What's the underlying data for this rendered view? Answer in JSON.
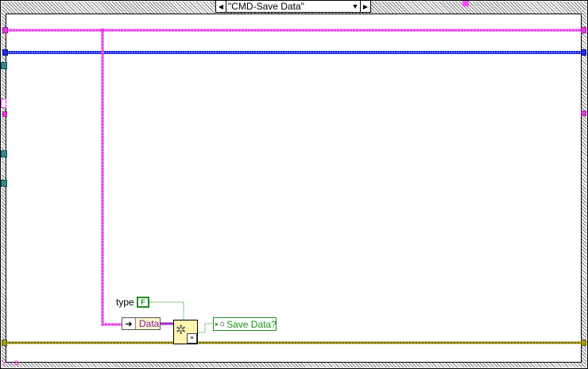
{
  "case_selector": {
    "value": "\"CMD-Save Data\"",
    "decrement_glyph": "◀",
    "increment_glyph": "▶",
    "dropdown_glyph": "▼"
  },
  "nodes": {
    "type_label": "type",
    "bool_constant": "F",
    "data_terminal": {
      "arrow": "➜",
      "label": "Data"
    },
    "save_indicator": {
      "arrow": "▸",
      "home": "⌂",
      "label": "Save Data?"
    }
  },
  "error_terminal": "?→a",
  "colors": {
    "cluster_wire": "#e936e9",
    "ref_wire": "#1f2fe0",
    "error_wire": "#a59a16",
    "boolean_wire": "#1f8f1f",
    "frame": "#000000"
  }
}
